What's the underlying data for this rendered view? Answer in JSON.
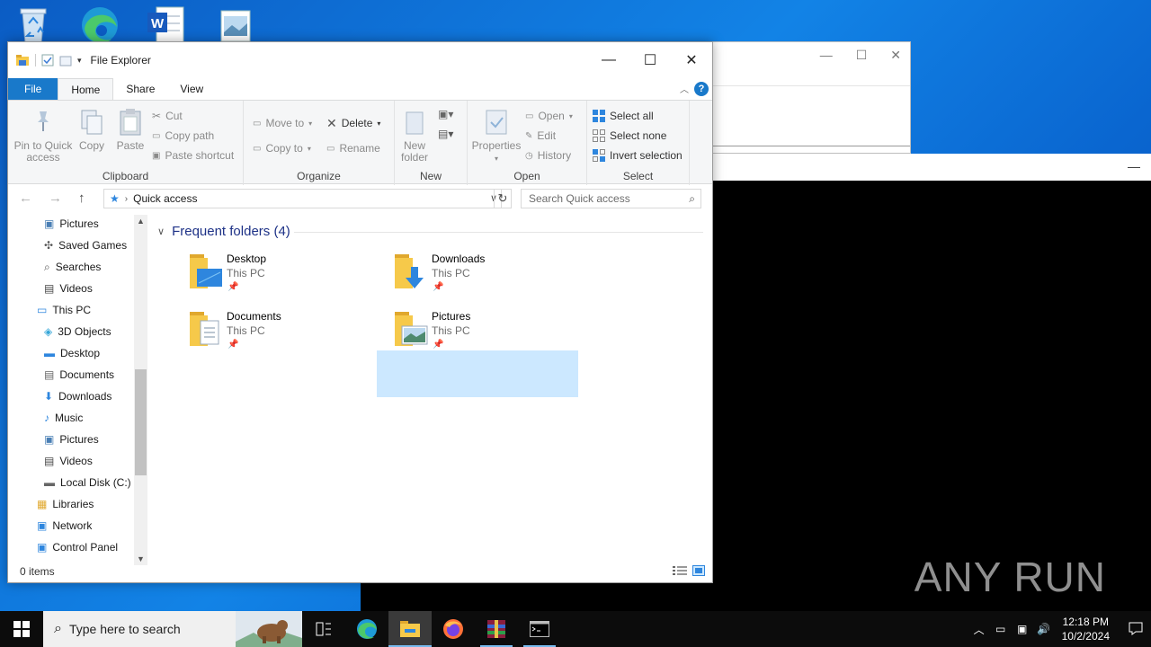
{
  "window": {
    "title": "File Explorer"
  },
  "ribbon": {
    "tabs": [
      "File",
      "Home",
      "Share",
      "View"
    ],
    "clipboard": {
      "label": "Clipboard",
      "pin": "Pin to Quick access",
      "copy": "Copy",
      "paste": "Paste",
      "cut": "Cut",
      "copy_path": "Copy path",
      "paste_shortcut": "Paste shortcut"
    },
    "organize": {
      "label": "Organize",
      "move_to": "Move to",
      "copy_to": "Copy to",
      "delete": "Delete",
      "rename": "Rename"
    },
    "new": {
      "label": "New",
      "new_folder": "New folder"
    },
    "open": {
      "label": "Open",
      "properties": "Properties",
      "open": "Open",
      "edit": "Edit",
      "history": "History"
    },
    "select": {
      "label": "Select",
      "select_all": "Select all",
      "select_none": "Select none",
      "invert": "Invert selection"
    }
  },
  "address": {
    "path": "Quick access",
    "search_placeholder": "Search Quick access"
  },
  "nav": {
    "items": [
      {
        "label": "Pictures",
        "icon": "pictures-icon"
      },
      {
        "label": "Saved Games",
        "icon": "saved-games-icon"
      },
      {
        "label": "Searches",
        "icon": "searches-icon"
      },
      {
        "label": "Videos",
        "icon": "videos-icon"
      },
      {
        "label": "This PC",
        "icon": "this-pc-icon"
      },
      {
        "label": "3D Objects",
        "icon": "3d-objects-icon"
      },
      {
        "label": "Desktop",
        "icon": "desktop-icon"
      },
      {
        "label": "Documents",
        "icon": "documents-icon"
      },
      {
        "label": "Downloads",
        "icon": "downloads-icon"
      },
      {
        "label": "Music",
        "icon": "music-icon"
      },
      {
        "label": "Pictures",
        "icon": "pictures-icon"
      },
      {
        "label": "Videos",
        "icon": "videos-icon"
      },
      {
        "label": "Local Disk (C:)",
        "icon": "local-disk-icon"
      },
      {
        "label": "Libraries",
        "icon": "libraries-icon"
      },
      {
        "label": "Network",
        "icon": "network-icon"
      },
      {
        "label": "Control Panel",
        "icon": "control-panel-icon"
      }
    ]
  },
  "content": {
    "group_header": "Frequent folders (4)",
    "folders": [
      {
        "name": "Desktop",
        "location": "This PC",
        "icon": "desktop-folder-icon"
      },
      {
        "name": "Downloads",
        "location": "This PC",
        "icon": "downloads-folder-icon"
      },
      {
        "name": "Documents",
        "location": "This PC",
        "icon": "documents-folder-icon"
      },
      {
        "name": "Pictures",
        "location": "This PC",
        "icon": "pictures-folder-icon",
        "selected": true
      }
    ]
  },
  "status": {
    "items": "0 items"
  },
  "taskbar": {
    "search_placeholder": "Type here to search",
    "apps": [
      "task-view-icon",
      "edge-icon",
      "file-explorer-icon",
      "firefox-icon",
      "winrar-icon",
      "terminal-icon"
    ],
    "time": "12:18 PM",
    "date": "10/2/2024"
  },
  "watermark": {
    "text": "ANY RUN"
  },
  "colors": {
    "accent": "#1979ca",
    "selection": "#cce8ff",
    "header": "#1e3287",
    "folder": "#f6c94a"
  }
}
